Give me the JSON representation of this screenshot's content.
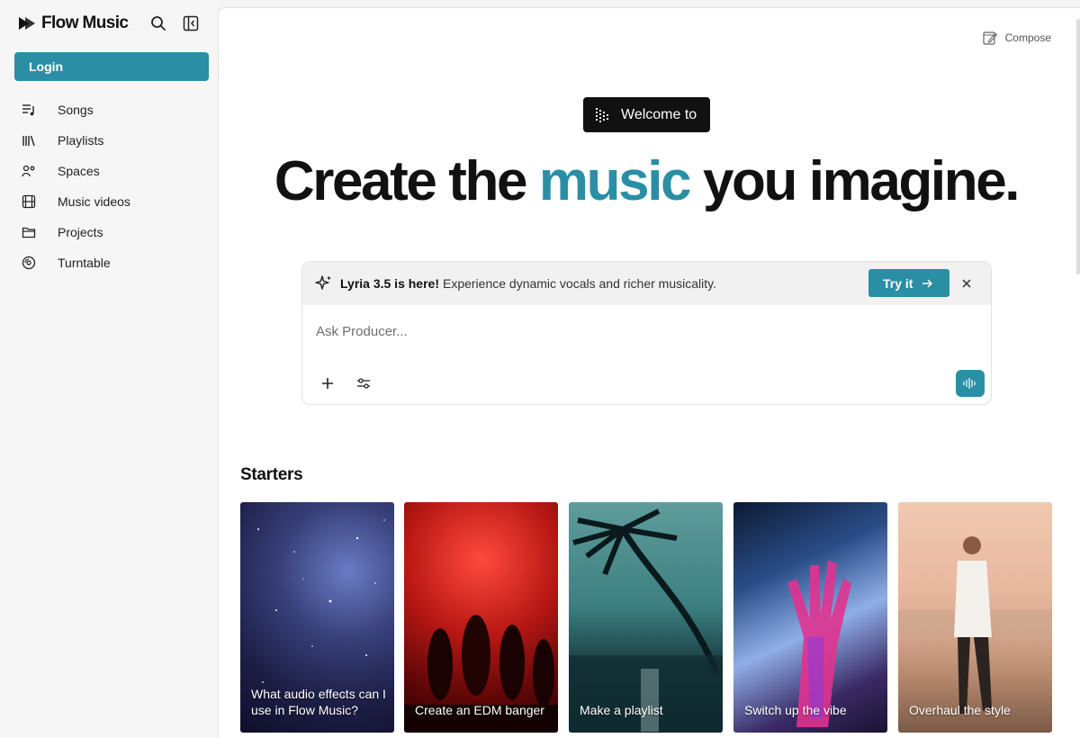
{
  "brand": {
    "name": "Flow Music"
  },
  "sidebar": {
    "login_label": "Login",
    "items": [
      {
        "label": "Songs",
        "icon": "songs-icon"
      },
      {
        "label": "Playlists",
        "icon": "library-icon"
      },
      {
        "label": "Spaces",
        "icon": "spaces-icon"
      },
      {
        "label": "Music videos",
        "icon": "film-icon"
      },
      {
        "label": "Projects",
        "icon": "folder-icon"
      },
      {
        "label": "Turntable",
        "icon": "turntable-icon"
      }
    ]
  },
  "header": {
    "compose_label": "Compose"
  },
  "hero": {
    "welcome_label": "Welcome to",
    "title_part1": "Create the ",
    "title_accent": "music",
    "title_part2": " you imagine."
  },
  "announcement": {
    "title": "Lyria 3.5 is here!",
    "text": "Experience dynamic vocals and richer musicality.",
    "button_label": "Try it"
  },
  "prompt": {
    "placeholder": "Ask Producer..."
  },
  "starters": {
    "title": "Starters",
    "cards": [
      {
        "label": "What audio effects can I use in Flow Music?"
      },
      {
        "label": "Create an EDM banger"
      },
      {
        "label": "Make a playlist"
      },
      {
        "label": "Switch up the vibe"
      },
      {
        "label": "Overhaul the style"
      }
    ]
  },
  "colors": {
    "accent": "#2a8fa5",
    "welcome_bg": "#111111"
  }
}
